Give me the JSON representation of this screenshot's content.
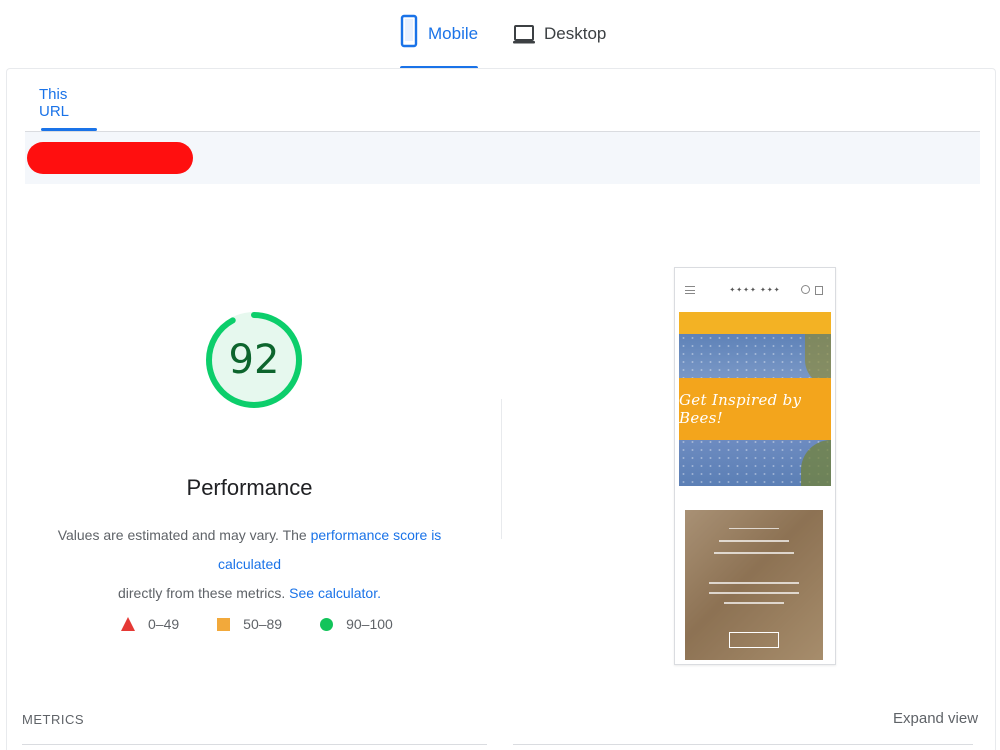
{
  "device_tabs": {
    "mobile_label": "Mobile",
    "desktop_label": "Desktop",
    "selected": "Mobile"
  },
  "url_tabs": {
    "this_url_label": "This URL"
  },
  "url_bar": {
    "redacted": true
  },
  "performance": {
    "score": "92",
    "score_fraction": 0.92,
    "title": "Performance",
    "desc_part1": "Values are estimated and may vary. The ",
    "desc_link1": "performance score is calculated",
    "desc_part2": " directly from these metrics. ",
    "desc_link2": "See calculator."
  },
  "legend": [
    {
      "label": "0–49",
      "shape": "triangle",
      "color": "#e53935"
    },
    {
      "label": "50–89",
      "shape": "square",
      "color": "#f2a93b"
    },
    {
      "label": "90–100",
      "shape": "circle",
      "color": "#12c45a"
    }
  ],
  "colors": {
    "accent": "#1a73e8",
    "pass": "#0cce6b",
    "pass_text": "#0d652d",
    "redaction": "#ff0f0f"
  },
  "screenshot": {
    "hero_text": "Get Inspired by Bees!"
  },
  "metrics": {
    "label": "METRICS",
    "expand_label": "Expand view"
  }
}
